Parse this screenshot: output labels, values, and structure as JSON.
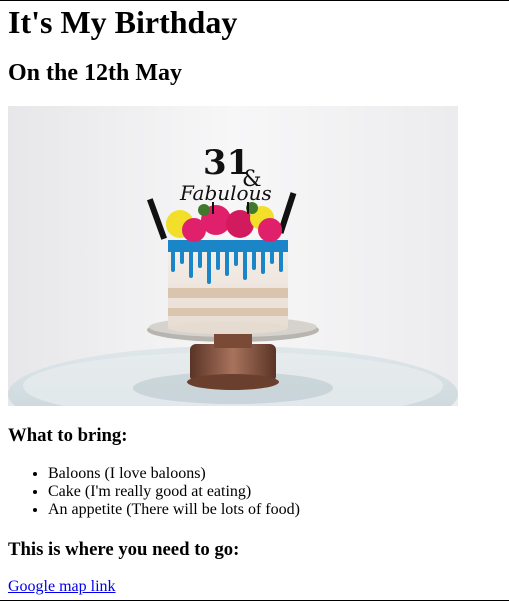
{
  "header": {
    "title": "It's My Birthday",
    "subtitle": "On the 12th May"
  },
  "image": {
    "topper_number": "31",
    "topper_ampersand": "&",
    "topper_word": "Fabulous"
  },
  "bring": {
    "heading": "What to bring:",
    "items": [
      "Baloons (I love baloons)",
      "Cake (I'm really good at eating)",
      "An appetite (There will be lots of food)"
    ]
  },
  "location": {
    "heading": "This is where you need to go:",
    "link_text": "Google map link"
  },
  "colors": {
    "link": "#0000ee",
    "drip": "#1a86c8",
    "flower_pink": "#e0206a",
    "flower_yellow": "#f2df2a"
  }
}
